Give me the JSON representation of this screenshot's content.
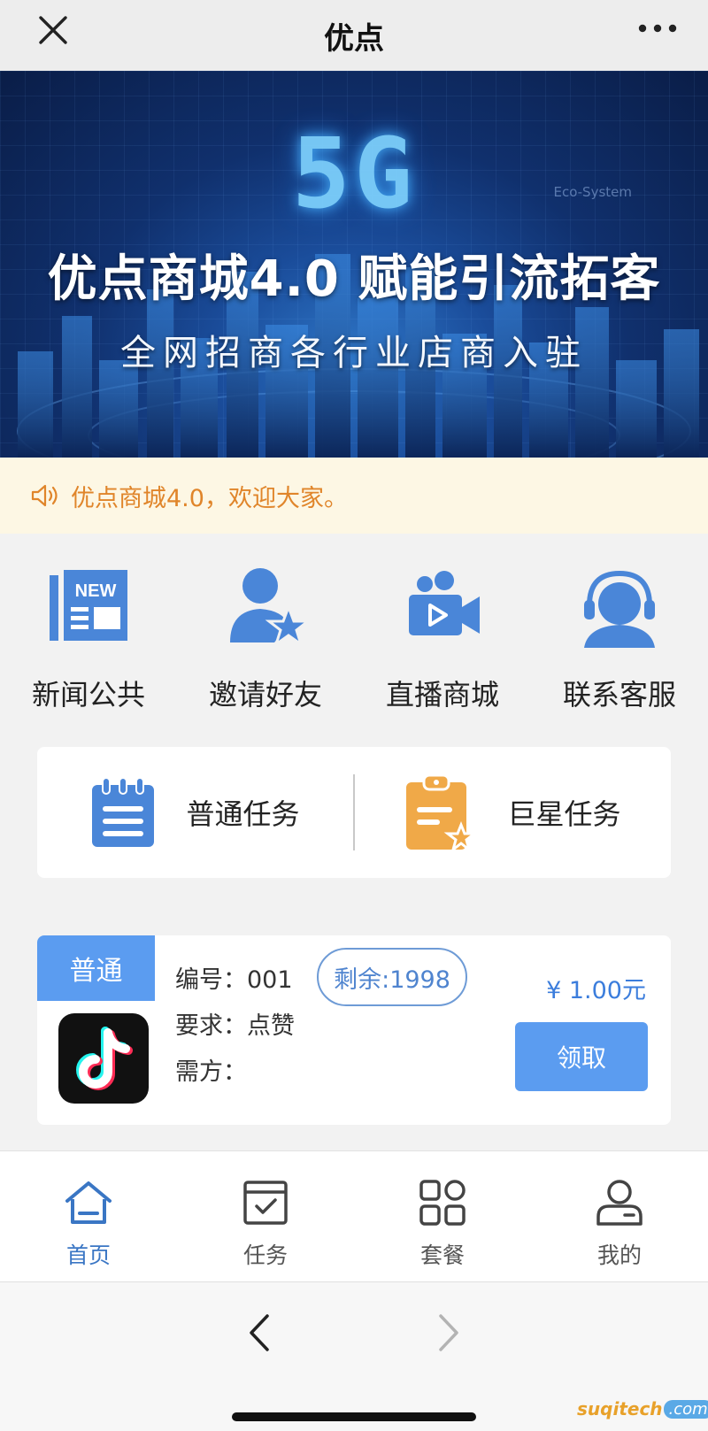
{
  "titlebar": {
    "title": "优点"
  },
  "banner": {
    "big_text": "5G",
    "eco_text": "Eco-System",
    "headline": "优点商城4.0 赋能引流拓客",
    "subline": "全网招商各行业店商入驻"
  },
  "notice": {
    "text": "优点商城4.0，欢迎大家。"
  },
  "quick_nav": [
    {
      "label": "新闻公共",
      "icon": "news-icon"
    },
    {
      "label": "邀请好友",
      "icon": "invite-friend-icon"
    },
    {
      "label": "直播商城",
      "icon": "live-video-icon"
    },
    {
      "label": "联系客服",
      "icon": "customer-service-icon"
    }
  ],
  "task_types": [
    {
      "label": "普通任务",
      "icon": "notepad-icon"
    },
    {
      "label": "巨星任务",
      "icon": "clipboard-star-icon"
    }
  ],
  "listing": {
    "tag": "普通",
    "number_line": "编号：001",
    "remaining": "剩余:1998",
    "requirement_line": "要求：点赞",
    "demander_line": "需方：",
    "price": "¥ 1.00元",
    "claim_label": "领取",
    "logo_icon": "tiktok-logo-icon"
  },
  "tabbar": [
    {
      "label": "首页",
      "icon": "home-icon",
      "active": true
    },
    {
      "label": "任务",
      "icon": "task-check-icon",
      "active": false
    },
    {
      "label": "套餐",
      "icon": "grid-icon",
      "active": false
    },
    {
      "label": "我的",
      "icon": "user-icon",
      "active": false
    }
  ],
  "watermark": {
    "part1": "suqitech",
    "part2": ".com"
  },
  "colors": {
    "accent": "#5b9cf0",
    "notice_text": "#e0852a",
    "notice_bg": "#fdf7e4",
    "price": "#3b7ddc"
  }
}
